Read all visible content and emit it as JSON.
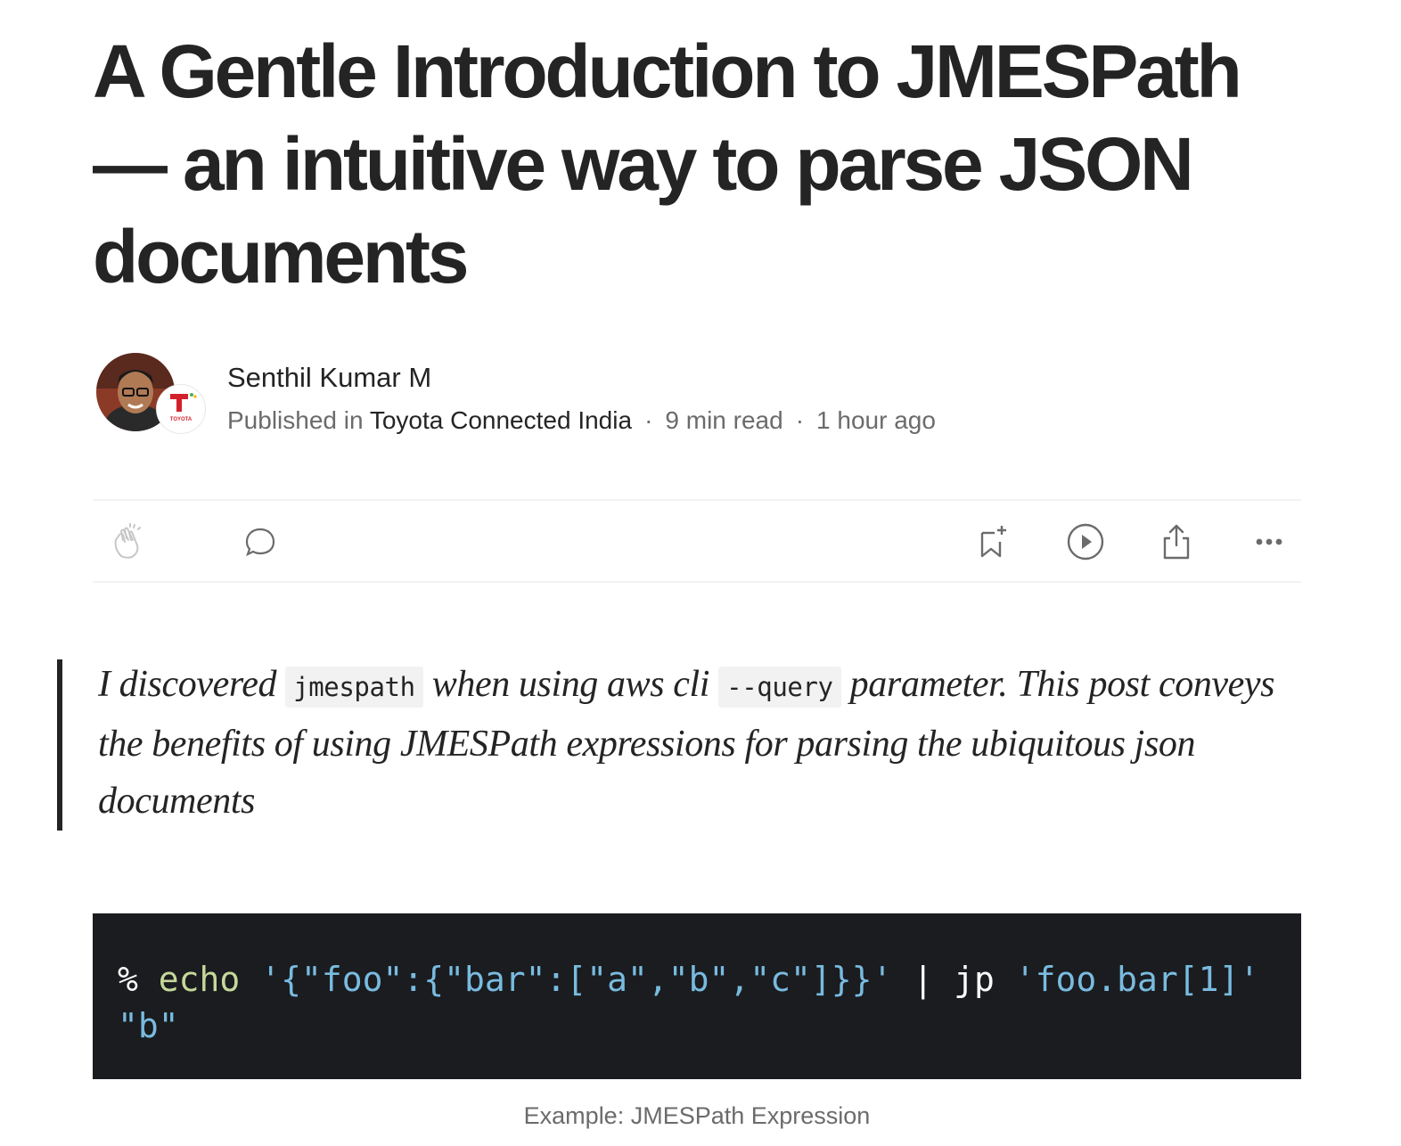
{
  "article": {
    "title": "A Gentle Introduction to JMESPath — an intuitive way to parse JSON documents"
  },
  "author": {
    "name": "Senthil Kumar M",
    "published_prefix": "Published in",
    "publication": "Toyota Connected India",
    "read_time": "9 min read",
    "published_ago": "1 hour ago",
    "badge_text": "TOYOTA"
  },
  "actions": {
    "clap": "clap-icon",
    "comment": "comment-icon",
    "save": "bookmark-add-icon",
    "listen": "play-icon",
    "share": "share-icon",
    "more": "more-icon"
  },
  "quote": {
    "part1": "I discovered ",
    "code1": "jmespath",
    "part2": " when using aws cli ",
    "code2": "--query",
    "part3": " parameter. This post conveys the benefits of using JMESPath expressions for parsing the ubiquitous json documents"
  },
  "code_block": {
    "prompt": "%",
    "cmd": "echo",
    "json_arg": "'{\"foo\":{\"bar\":[\"a\",\"b\",\"c\"]}}'",
    "pipe": "|",
    "tool": "jp",
    "expr": "'foo.bar[1]'",
    "output": "\"b\""
  },
  "caption": "Example: JMESPath Expression",
  "colors": {
    "text": "#242424",
    "muted": "#6b6b6b",
    "code_bg": "#1a1c1f",
    "code_cmd": "#c5d89a",
    "code_str": "#79bbe0",
    "badge_red": "#d3212c"
  }
}
